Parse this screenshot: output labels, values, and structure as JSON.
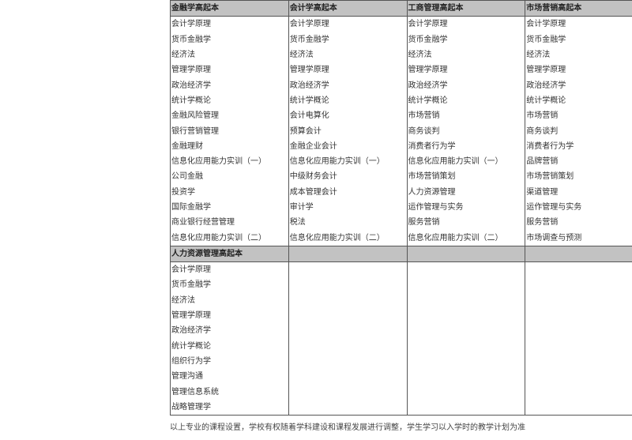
{
  "table": {
    "sections": [
      {
        "headers": [
          "金融学高起本",
          "会计学高起本",
          "工商管理高起本",
          "市场营销高起本"
        ],
        "columns": [
          [
            "会计学原理",
            "货币金融学",
            "经济法",
            "管理学原理",
            "政治经济学",
            "统计学概论",
            "金融风险管理",
            "银行营销管理",
            "金融理财",
            "信息化应用能力实训（一）",
            "公司金融",
            "投资学",
            "国际金融学",
            "商业银行经营管理",
            "信息化应用能力实训（二）"
          ],
          [
            "会计学原理",
            "货币金融学",
            "经济法",
            "管理学原理",
            "政治经济学",
            "统计学概论",
            "会计电算化",
            "预算会计",
            "金融企业会计",
            "信息化应用能力实训（一）",
            "中级财务会计",
            "成本管理会计",
            "审计学",
            "税法",
            "信息化应用能力实训（二）"
          ],
          [
            "会计学原理",
            "货币金融学",
            "经济法",
            "管理学原理",
            "政治经济学",
            "统计学概论",
            "市场营销",
            "商务谈判",
            "消费者行为学",
            "信息化应用能力实训（一）",
            "市场营销策划",
            "人力资源管理",
            "运作管理与实务",
            "服务营销",
            "信息化应用能力实训（二）"
          ],
          [
            "会计学原理",
            "货币金融学",
            "经济法",
            "管理学原理",
            "政治经济学",
            "统计学概论",
            "市场营销",
            "商务谈判",
            "消费者行为学",
            "品牌营销",
            "市场营销策划",
            "渠道管理",
            "运作管理与实务",
            "服务营销",
            "市场调查与预测"
          ]
        ]
      },
      {
        "headers": [
          "人力资源管理高起本",
          "",
          "",
          ""
        ],
        "columns": [
          [
            "会计学原理",
            "货币金融学",
            "经济法",
            "管理学原理",
            "政治经济学",
            "统计学概论",
            "组织行为学",
            "管理沟通",
            "管理信息系统",
            "战略管理学"
          ],
          [
            "",
            "",
            "",
            "",
            "",
            "",
            "",
            "",
            "",
            ""
          ],
          [
            "",
            "",
            "",
            "",
            "",
            "",
            "",
            "",
            "",
            ""
          ],
          [
            "",
            "",
            "",
            "",
            "",
            "",
            "",
            "",
            "",
            ""
          ]
        ]
      }
    ]
  },
  "footer_note": "以上专业的课程设置，学校有权随着学科建设和课程发展进行调整，学生学习以入学时的教学计划为准"
}
